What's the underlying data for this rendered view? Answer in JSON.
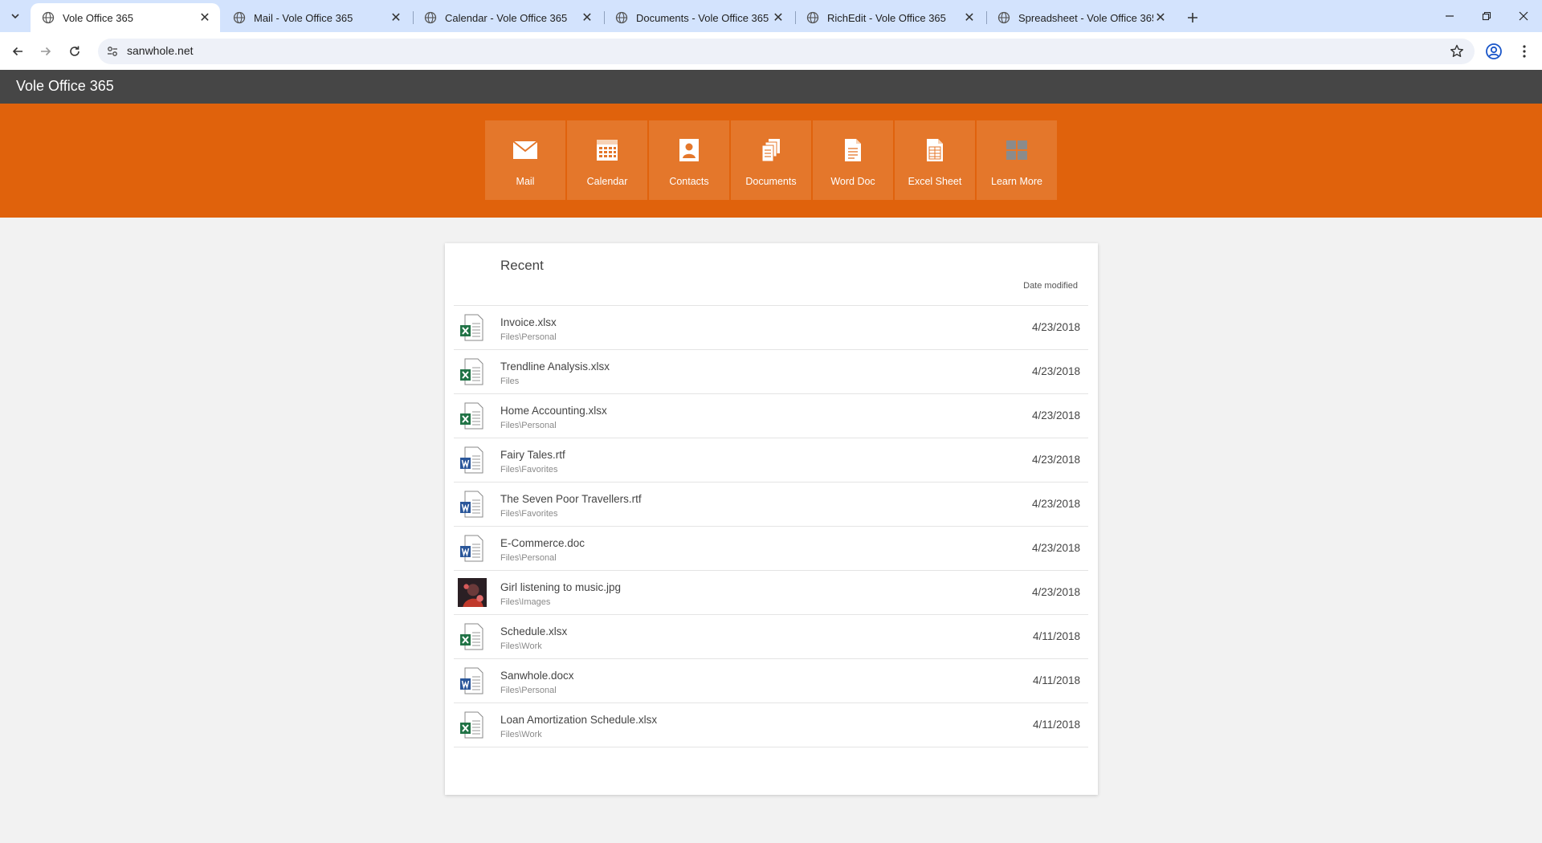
{
  "browser": {
    "tabs": [
      {
        "title": "Vole Office 365",
        "active": true
      },
      {
        "title": "Mail - Vole Office 365",
        "active": false
      },
      {
        "title": "Calendar - Vole Office 365",
        "active": false
      },
      {
        "title": "Documents - Vole Office 365",
        "active": false
      },
      {
        "title": "RichEdit - Vole Office 365",
        "active": false
      },
      {
        "title": "Spreadsheet - Vole Office 365",
        "active": false
      }
    ],
    "url": "sanwhole.net"
  },
  "app": {
    "title": "Vole Office 365",
    "accent_color": "#e0620c",
    "header_color": "#464646",
    "launcher": [
      {
        "label": "Mail",
        "icon": "mail-icon"
      },
      {
        "label": "Calendar",
        "icon": "calendar-icon"
      },
      {
        "label": "Contacts",
        "icon": "contacts-icon"
      },
      {
        "label": "Documents",
        "icon": "documents-icon"
      },
      {
        "label": "Word Doc",
        "icon": "word-doc-icon"
      },
      {
        "label": "Excel Sheet",
        "icon": "excel-sheet-icon"
      },
      {
        "label": "Learn More",
        "icon": "learn-more-icon"
      }
    ]
  },
  "recent": {
    "title": "Recent",
    "date_header": "Date modified",
    "files": [
      {
        "name": "Invoice.xlsx",
        "path": "Files\\Personal",
        "date": "4/23/2018",
        "type": "excel"
      },
      {
        "name": "Trendline Analysis.xlsx",
        "path": "Files",
        "date": "4/23/2018",
        "type": "excel"
      },
      {
        "name": "Home Accounting.xlsx",
        "path": "Files\\Personal",
        "date": "4/23/2018",
        "type": "excel"
      },
      {
        "name": "Fairy Tales.rtf",
        "path": "Files\\Favorites",
        "date": "4/23/2018",
        "type": "word"
      },
      {
        "name": "The Seven Poor Travellers.rtf",
        "path": "Files\\Favorites",
        "date": "4/23/2018",
        "type": "word"
      },
      {
        "name": "E-Commerce.doc",
        "path": "Files\\Personal",
        "date": "4/23/2018",
        "type": "word"
      },
      {
        "name": "Girl listening to music.jpg",
        "path": "Files\\Images",
        "date": "4/23/2018",
        "type": "image"
      },
      {
        "name": "Schedule.xlsx",
        "path": "Files\\Work",
        "date": "4/11/2018",
        "type": "excel"
      },
      {
        "name": "Sanwhole.docx",
        "path": "Files\\Personal",
        "date": "4/11/2018",
        "type": "word"
      },
      {
        "name": "Loan Amortization Schedule.xlsx",
        "path": "Files\\Work",
        "date": "4/11/2018",
        "type": "excel"
      }
    ]
  }
}
